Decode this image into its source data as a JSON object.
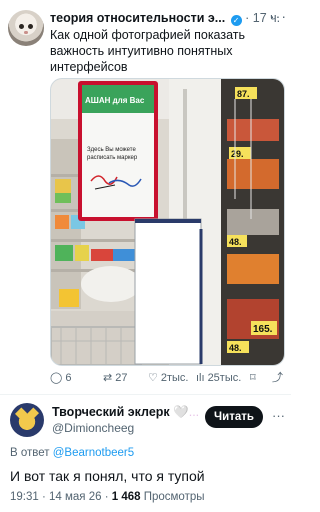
{
  "tweet": {
    "author_name": "теория относительности э...",
    "time": "17 ч.",
    "more_label": "···",
    "text": "Как одной фотографией показать важность интуитивно понятных интерфейсов",
    "photo": {
      "sign_header": "АШАН для Вас",
      "sign_text": "Здесь Вы можете расписать маркер",
      "prices": [
        "87.",
        "29.",
        "48.",
        "165.",
        "48."
      ]
    },
    "actions": {
      "replies": "6",
      "retweets": "27",
      "likes": "2тыс.",
      "views": "25тыс."
    }
  },
  "reply": {
    "author_name": "Творческий эклерк",
    "author_suffix": "🤍...",
    "handle": "@Dimioncheeg",
    "follow_label": "Читать",
    "more_label": "···",
    "in_reply_prefix": "В ответ",
    "in_reply_handle": "@Bearnotbeer5",
    "text": "И вот так я понял, что я тупой",
    "time": "19:31 · 14 мая 26 ·",
    "views_count": "1 468",
    "views_label": "Просмотры"
  },
  "colors": {
    "accent": "#1d9bf0",
    "text": "#0f1419",
    "muted": "#536471",
    "auchan_red": "#c8102e",
    "auchan_green": "#3aa35b"
  }
}
